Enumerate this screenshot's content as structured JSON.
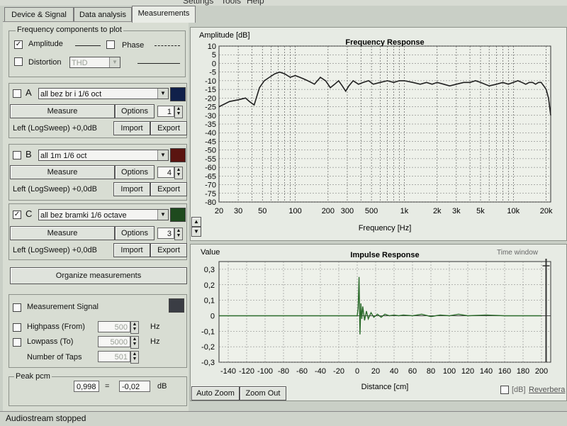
{
  "menu": [
    "Settings",
    "Tools",
    "Help"
  ],
  "tabs": [
    {
      "label": "Device & Signal",
      "active": false
    },
    {
      "label": "Data analysis",
      "active": false
    },
    {
      "label": "Measurements",
      "active": true
    }
  ],
  "freq_components": {
    "title": "Frequency components to plot",
    "amplitude_label": "Amplitude",
    "amplitude_checked": true,
    "phase_label": "Phase",
    "phase_checked": false,
    "distortion_label": "Distortion",
    "distortion_checked": false,
    "distortion_value": "THD"
  },
  "measurements": [
    {
      "letter": "A",
      "checked": false,
      "name": "all bez br i 1/6 oct",
      "color": "#10204a",
      "measure_label": "Measure",
      "options_label": "Options",
      "count": "1",
      "source": "Left (LogSweep) +0,0dB",
      "import_label": "Import",
      "export_label": "Export"
    },
    {
      "letter": "B",
      "checked": false,
      "name": "all 1m 1/6 oct",
      "color": "#5a1410",
      "measure_label": "Measure",
      "options_label": "Options",
      "count": "4",
      "source": "Left (LogSweep) +0,0dB",
      "import_label": "Import",
      "export_label": "Export"
    },
    {
      "letter": "C",
      "checked": true,
      "name": "all bez bramki 1/6 octave",
      "color": "#1e4a1e",
      "measure_label": "Measure",
      "options_label": "Options",
      "count": "3",
      "source": "Left (LogSweep) +0,0dB",
      "import_label": "Import",
      "export_label": "Export"
    }
  ],
  "organize_label": "Organize measurements",
  "signal": {
    "title": "Measurement Signal",
    "color": "#3a3d44",
    "highpass_label": "Highpass (From)",
    "highpass_value": "500",
    "lowpass_label": "Lowpass (To)",
    "lowpass_value": "5000",
    "hz": "Hz",
    "taps_label": "Number of Taps",
    "taps_value": "501"
  },
  "peak": {
    "label": "Peak pcm",
    "value1": "0,998",
    "eq": "=",
    "value2": "-0,02",
    "unit": "dB"
  },
  "status": "Audiostream stopped",
  "bottom_controls": {
    "auto_zoom": "Auto Zoom",
    "zoom_out": "Zoom Out",
    "db_label": "[dB]",
    "reverb_label": "Reverbera"
  },
  "chart_data": [
    {
      "type": "line",
      "title": "Frequency Response",
      "ylabel": "Amplitude [dB]",
      "xlabel": "Frequency [Hz]",
      "xscale": "log",
      "xlim": [
        20,
        22000
      ],
      "ylim": [
        -80,
        10
      ],
      "grid": true,
      "xticks": [
        20,
        30,
        50,
        100,
        200,
        300,
        500,
        1000,
        2000,
        3000,
        5000,
        10000,
        20000
      ],
      "xticklabels": [
        "20",
        "30",
        "50",
        "100",
        "200",
        "300",
        "500",
        "1k",
        "2k",
        "3k",
        "5k",
        "10k",
        "20k"
      ],
      "yticks": [
        10,
        5,
        0,
        -5,
        -10,
        -15,
        -20,
        -25,
        -30,
        -35,
        -40,
        -45,
        -50,
        -55,
        -60,
        -65,
        -70,
        -75,
        -80
      ],
      "series": [
        {
          "color": "#202020",
          "x": [
            20,
            25,
            30,
            35,
            38,
            42,
            47,
            52,
            58,
            65,
            72,
            80,
            90,
            100,
            110,
            120,
            130,
            140,
            150,
            170,
            190,
            210,
            230,
            250,
            270,
            290,
            310,
            340,
            380,
            420,
            470,
            520,
            600,
            700,
            800,
            900,
            1000,
            1200,
            1400,
            1600,
            1800,
            2000,
            2300,
            2600,
            3000,
            3500,
            4000,
            4500,
            5000,
            6000,
            7000,
            8000,
            9000,
            10000,
            11000,
            12000,
            13000,
            14000,
            15000,
            16000,
            17000,
            18000,
            19000,
            20000,
            21000,
            22000
          ],
          "y": [
            -25,
            -22,
            -21,
            -20,
            -22,
            -24,
            -14,
            -10,
            -8,
            -6,
            -5,
            -6,
            -8,
            -7,
            -8,
            -9,
            -10,
            -11,
            -12,
            -8,
            -10,
            -14,
            -12,
            -10,
            -13,
            -16,
            -13,
            -10,
            -12,
            -11,
            -10,
            -12,
            -11,
            -10,
            -11,
            -10,
            -10,
            -11,
            -12,
            -11,
            -12,
            -11,
            -12,
            -13,
            -12,
            -11,
            -11,
            -10,
            -11,
            -13,
            -12,
            -11,
            -12,
            -11,
            -10,
            -11,
            -12,
            -11,
            -11,
            -12,
            -11,
            -11,
            -13,
            -15,
            -20,
            -30
          ]
        }
      ]
    },
    {
      "type": "line",
      "title": "Impulse Response",
      "ylabel": "Value",
      "xlabel": "Distance [cm]",
      "xlim": [
        -150,
        210
      ],
      "ylim": [
        -0.3,
        0.35
      ],
      "grid": true,
      "xticks": [
        -140,
        -120,
        -100,
        -80,
        -60,
        -40,
        -20,
        0,
        20,
        40,
        60,
        80,
        100,
        120,
        140,
        160,
        180,
        200
      ],
      "yticks": [
        0.3,
        0.2,
        0.1,
        0,
        -0.1,
        -0.2,
        -0.3
      ],
      "yticklabels": [
        "0,3",
        "0,2",
        "0,1",
        "0",
        "-0,1",
        "-0,2",
        "-0,3"
      ],
      "time_window_label": "Time window",
      "time_window_range": [
        -150,
        205
      ],
      "series": [
        {
          "color": "#2b6b2b",
          "x": [
            -150,
            -10,
            0,
            1,
            2,
            3,
            4,
            5,
            6,
            8,
            10,
            12,
            15,
            18,
            22,
            26,
            30,
            35,
            40,
            45,
            50,
            60,
            70,
            80,
            90,
            100,
            110,
            120,
            140,
            160,
            180,
            200
          ],
          "y": [
            0,
            0,
            0,
            0.05,
            0.25,
            -0.12,
            0.08,
            -0.02,
            0.06,
            -0.03,
            0.03,
            -0.02,
            0.02,
            -0.01,
            0.01,
            -0.01,
            0.01,
            0,
            0.005,
            0,
            0.005,
            0,
            0.01,
            -0.005,
            0.005,
            0,
            0.01,
            0,
            0.005,
            0,
            0,
            0
          ]
        }
      ]
    }
  ]
}
